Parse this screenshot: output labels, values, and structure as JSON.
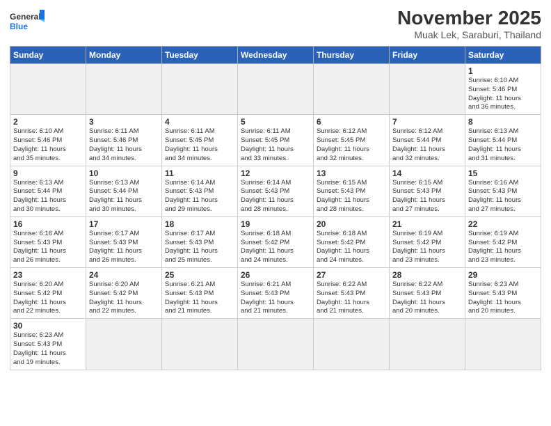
{
  "logo": {
    "text_general": "General",
    "text_blue": "Blue"
  },
  "header": {
    "month_year": "November 2025",
    "location": "Muak Lek, Saraburi, Thailand"
  },
  "weekdays": [
    "Sunday",
    "Monday",
    "Tuesday",
    "Wednesday",
    "Thursday",
    "Friday",
    "Saturday"
  ],
  "weeks": [
    [
      {
        "day": "",
        "info": ""
      },
      {
        "day": "",
        "info": ""
      },
      {
        "day": "",
        "info": ""
      },
      {
        "day": "",
        "info": ""
      },
      {
        "day": "",
        "info": ""
      },
      {
        "day": "",
        "info": ""
      },
      {
        "day": "1",
        "info": "Sunrise: 6:10 AM\nSunset: 5:46 PM\nDaylight: 11 hours\nand 36 minutes."
      }
    ],
    [
      {
        "day": "2",
        "info": "Sunrise: 6:10 AM\nSunset: 5:46 PM\nDaylight: 11 hours\nand 35 minutes."
      },
      {
        "day": "3",
        "info": "Sunrise: 6:11 AM\nSunset: 5:46 PM\nDaylight: 11 hours\nand 34 minutes."
      },
      {
        "day": "4",
        "info": "Sunrise: 6:11 AM\nSunset: 5:45 PM\nDaylight: 11 hours\nand 34 minutes."
      },
      {
        "day": "5",
        "info": "Sunrise: 6:11 AM\nSunset: 5:45 PM\nDaylight: 11 hours\nand 33 minutes."
      },
      {
        "day": "6",
        "info": "Sunrise: 6:12 AM\nSunset: 5:45 PM\nDaylight: 11 hours\nand 32 minutes."
      },
      {
        "day": "7",
        "info": "Sunrise: 6:12 AM\nSunset: 5:44 PM\nDaylight: 11 hours\nand 32 minutes."
      },
      {
        "day": "8",
        "info": "Sunrise: 6:13 AM\nSunset: 5:44 PM\nDaylight: 11 hours\nand 31 minutes."
      }
    ],
    [
      {
        "day": "9",
        "info": "Sunrise: 6:13 AM\nSunset: 5:44 PM\nDaylight: 11 hours\nand 30 minutes."
      },
      {
        "day": "10",
        "info": "Sunrise: 6:13 AM\nSunset: 5:44 PM\nDaylight: 11 hours\nand 30 minutes."
      },
      {
        "day": "11",
        "info": "Sunrise: 6:14 AM\nSunset: 5:43 PM\nDaylight: 11 hours\nand 29 minutes."
      },
      {
        "day": "12",
        "info": "Sunrise: 6:14 AM\nSunset: 5:43 PM\nDaylight: 11 hours\nand 28 minutes."
      },
      {
        "day": "13",
        "info": "Sunrise: 6:15 AM\nSunset: 5:43 PM\nDaylight: 11 hours\nand 28 minutes."
      },
      {
        "day": "14",
        "info": "Sunrise: 6:15 AM\nSunset: 5:43 PM\nDaylight: 11 hours\nand 27 minutes."
      },
      {
        "day": "15",
        "info": "Sunrise: 6:16 AM\nSunset: 5:43 PM\nDaylight: 11 hours\nand 27 minutes."
      }
    ],
    [
      {
        "day": "16",
        "info": "Sunrise: 6:16 AM\nSunset: 5:43 PM\nDaylight: 11 hours\nand 26 minutes."
      },
      {
        "day": "17",
        "info": "Sunrise: 6:17 AM\nSunset: 5:43 PM\nDaylight: 11 hours\nand 26 minutes."
      },
      {
        "day": "18",
        "info": "Sunrise: 6:17 AM\nSunset: 5:43 PM\nDaylight: 11 hours\nand 25 minutes."
      },
      {
        "day": "19",
        "info": "Sunrise: 6:18 AM\nSunset: 5:42 PM\nDaylight: 11 hours\nand 24 minutes."
      },
      {
        "day": "20",
        "info": "Sunrise: 6:18 AM\nSunset: 5:42 PM\nDaylight: 11 hours\nand 24 minutes."
      },
      {
        "day": "21",
        "info": "Sunrise: 6:19 AM\nSunset: 5:42 PM\nDaylight: 11 hours\nand 23 minutes."
      },
      {
        "day": "22",
        "info": "Sunrise: 6:19 AM\nSunset: 5:42 PM\nDaylight: 11 hours\nand 23 minutes."
      }
    ],
    [
      {
        "day": "23",
        "info": "Sunrise: 6:20 AM\nSunset: 5:42 PM\nDaylight: 11 hours\nand 22 minutes."
      },
      {
        "day": "24",
        "info": "Sunrise: 6:20 AM\nSunset: 5:42 PM\nDaylight: 11 hours\nand 22 minutes."
      },
      {
        "day": "25",
        "info": "Sunrise: 6:21 AM\nSunset: 5:43 PM\nDaylight: 11 hours\nand 21 minutes."
      },
      {
        "day": "26",
        "info": "Sunrise: 6:21 AM\nSunset: 5:43 PM\nDaylight: 11 hours\nand 21 minutes."
      },
      {
        "day": "27",
        "info": "Sunrise: 6:22 AM\nSunset: 5:43 PM\nDaylight: 11 hours\nand 21 minutes."
      },
      {
        "day": "28",
        "info": "Sunrise: 6:22 AM\nSunset: 5:43 PM\nDaylight: 11 hours\nand 20 minutes."
      },
      {
        "day": "29",
        "info": "Sunrise: 6:23 AM\nSunset: 5:43 PM\nDaylight: 11 hours\nand 20 minutes."
      }
    ],
    [
      {
        "day": "30",
        "info": "Sunrise: 6:23 AM\nSunset: 5:43 PM\nDaylight: 11 hours\nand 19 minutes."
      },
      {
        "day": "",
        "info": ""
      },
      {
        "day": "",
        "info": ""
      },
      {
        "day": "",
        "info": ""
      },
      {
        "day": "",
        "info": ""
      },
      {
        "day": "",
        "info": ""
      },
      {
        "day": "",
        "info": ""
      }
    ]
  ]
}
